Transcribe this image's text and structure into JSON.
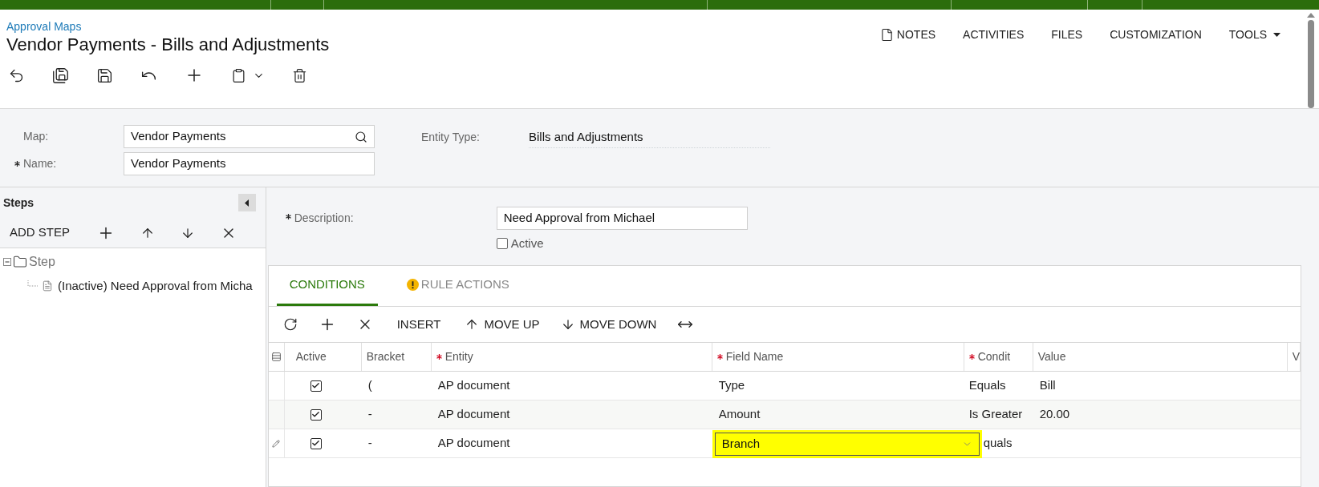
{
  "breadcrumb": "Approval Maps",
  "title": "Vendor Payments - Bills and Adjustments",
  "header_actions": [
    {
      "label": "NOTES",
      "kind": "notes"
    },
    {
      "label": "ACTIVITIES",
      "kind": "text"
    },
    {
      "label": "FILES",
      "kind": "text"
    },
    {
      "label": "CUSTOMIZATION",
      "kind": "text"
    },
    {
      "label": "TOOLS",
      "kind": "menu"
    }
  ],
  "form": {
    "map": {
      "label": "Map:",
      "value": "Vendor Payments",
      "required": false
    },
    "name": {
      "label": "Name:",
      "value": "Vendor Payments",
      "required": true
    },
    "entity_type": {
      "label": "Entity Type:",
      "value": "Bills and Adjustments"
    }
  },
  "steps": {
    "title": "Steps",
    "toolbar": [
      {
        "kind": "text",
        "label": "ADD STEP"
      },
      {
        "kind": "add"
      },
      {
        "kind": "up"
      },
      {
        "kind": "down"
      },
      {
        "kind": "delete"
      }
    ],
    "tree": [
      {
        "label": "Step",
        "expanded": true,
        "children": [
          {
            "label": "(Inactive) Need Approval from Micha"
          }
        ]
      }
    ]
  },
  "step": {
    "description": {
      "label": "Description:",
      "value": "Need Approval from Michael",
      "required": true
    },
    "active": {
      "label": "Active",
      "checked": false
    }
  },
  "tabs": [
    {
      "label": "CONDITIONS",
      "selected": true,
      "warning": false
    },
    {
      "label": "RULE ACTIONS",
      "selected": false,
      "warning": true
    }
  ],
  "grid_toolbar": [
    {
      "kind": "refresh"
    },
    {
      "kind": "add"
    },
    {
      "kind": "delete"
    },
    {
      "kind": "text",
      "label": "INSERT"
    },
    {
      "kind": "up",
      "label": "MOVE UP"
    },
    {
      "kind": "down",
      "label": "MOVE DOWN"
    },
    {
      "kind": "fit"
    }
  ],
  "table": {
    "columns": [
      {
        "label": "Active",
        "required": false
      },
      {
        "label": "Bracket",
        "required": false
      },
      {
        "label": "Entity",
        "required": true
      },
      {
        "label": "Field Name",
        "required": true
      },
      {
        "label": "Condit",
        "required": true
      },
      {
        "label": "Value",
        "required": false
      },
      {
        "label": "V",
        "required": false
      }
    ],
    "rows": [
      {
        "editing": false,
        "active": true,
        "brackets": "(",
        "entity": "AP document",
        "field_name": "Type",
        "highlighted": false,
        "condition": "Equals",
        "value": "Bill"
      },
      {
        "editing": false,
        "active": true,
        "brackets": "-",
        "entity": "AP document",
        "field_name": "Amount",
        "highlighted": false,
        "condition": "Is Greater",
        "value": "20.00"
      },
      {
        "editing": true,
        "active": true,
        "brackets": "-",
        "entity": "AP document",
        "field_name": "Branch",
        "highlighted": true,
        "condition": "quals"
      }
    ]
  }
}
